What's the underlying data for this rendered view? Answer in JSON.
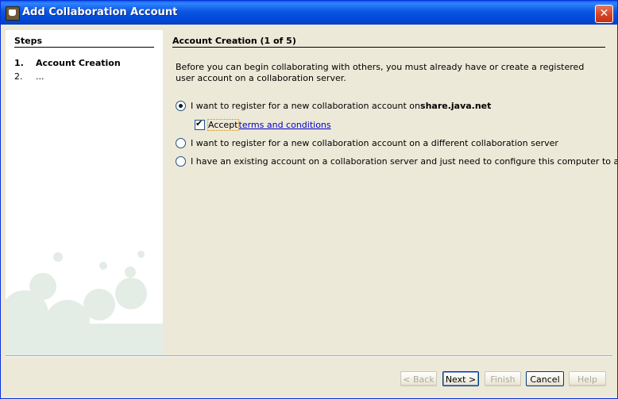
{
  "window": {
    "title": "Add Collaboration Account",
    "close_label": "✕"
  },
  "steps": {
    "title": "Steps",
    "items": [
      {
        "num": "1.",
        "label": "Account Creation"
      },
      {
        "num": "2.",
        "label": "..."
      }
    ]
  },
  "content": {
    "title": "Account Creation (1 of 5)",
    "intro": "Before you can begin collaborating with others, you must already have or create a registered user account on a collaboration server.",
    "option1_prefix": "I want to register for a new collaboration account on ",
    "option1_server": "share.java.net",
    "accept_label": "Accept",
    "terms_link": "terms and conditions",
    "option2": "I want to register for a new collaboration account on a different collaboration server",
    "option3": "I have an existing account on a collaboration server and just need to configure this computer to access it",
    "selected_option": 1,
    "accept_checked": true
  },
  "buttons": {
    "back": "< Back",
    "next": "Next >",
    "finish": "Finish",
    "cancel": "Cancel",
    "help": "Help"
  }
}
